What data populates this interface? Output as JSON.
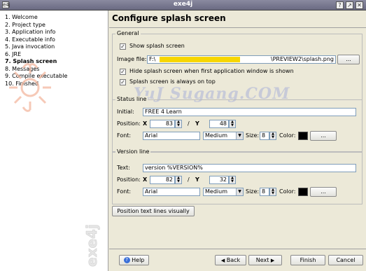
{
  "window": {
    "title": "exe4j",
    "app_icon": "e4j",
    "buttons": [
      "?",
      "↗",
      "✕"
    ]
  },
  "sidebar": {
    "items": [
      {
        "label": "1. Welcome",
        "active": false
      },
      {
        "label": "2. Project type",
        "active": false
      },
      {
        "label": "3. Application info",
        "active": false
      },
      {
        "label": "4. Executable info",
        "active": false
      },
      {
        "label": "5. Java invocation",
        "active": false
      },
      {
        "label": "6. JRE",
        "active": false
      },
      {
        "label": "7. Splash screen",
        "active": true
      },
      {
        "label": "8. Messages",
        "active": false
      },
      {
        "label": "9. Compile executable",
        "active": false
      },
      {
        "label": "10. Finished",
        "active": false
      }
    ],
    "brand": "exe4j"
  },
  "page": {
    "title": "Configure splash screen"
  },
  "general": {
    "legend": "General",
    "show_splash": {
      "label": "Show splash screen",
      "checked": true
    },
    "image_file": {
      "label": "Image file:",
      "prefix": "F:\\",
      "suffix": "\\PREVIEW2\\splash.png",
      "browse": "..."
    },
    "hide_splash": {
      "label": "Hide splash screen when first application window is shown",
      "checked": true
    },
    "always_on_top": {
      "label": "Splash screen is always on top",
      "checked": true
    }
  },
  "status_line": {
    "legend": "Status line",
    "initial_label": "Initial:",
    "initial_value": "FREE 4 Learn",
    "position_label": "Position:",
    "x_label": "X",
    "x_value": "83",
    "slash": "/",
    "y_label": "Y",
    "y_value": "48",
    "font_label": "Font:",
    "font_value": "Arial",
    "weight_value": "Medium",
    "size_label": "Size:",
    "size_value": "8",
    "color_label": "Color:",
    "color_value": "#000000",
    "color_button": "..."
  },
  "version_line": {
    "legend": "Version line",
    "text_label": "Text:",
    "text_value": "version %VERSION%",
    "position_label": "Position:",
    "x_label": "X",
    "x_value": "82",
    "slash": "/",
    "y_label": "Y",
    "y_value": "32",
    "font_label": "Font:",
    "font_value": "Arial",
    "weight_value": "Medium",
    "size_label": "Size:",
    "size_value": "8",
    "color_label": "Color:",
    "color_value": "#000000",
    "color_button": "..."
  },
  "position_visually_button": "Position text lines visually",
  "footer": {
    "help": "Help",
    "back": "Back",
    "next": "Next",
    "finish": "Finish",
    "cancel": "Cancel"
  },
  "watermark": "YuJ Sugang.COM"
}
